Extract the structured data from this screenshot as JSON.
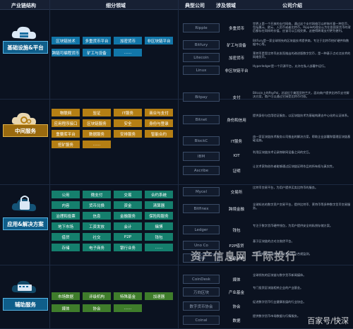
{
  "header": {
    "col_chain": "产业链结构",
    "col_sub": "细分领域",
    "col_company": "典型公司",
    "col_field": "涉及领域",
    "col_intro": "公司介绍"
  },
  "sections": [
    {
      "label": "基础设施&平台",
      "icon": "cloud-server-icon",
      "chips": [
        "区块链技术",
        "多重货币平台",
        "加密货币",
        "非区块链平台",
        "跨链可编程货币",
        "矿工与设备",
        "……"
      ]
    },
    {
      "label": "中间服务",
      "icon": "cloud-gears-icon",
      "chips": [
        "物联网",
        "验证",
        "IT服务",
        "商业与支付",
        "应用程序接口",
        "区块链服务",
        "安全",
        "身份与登录",
        "重要库平台",
        "数据服务",
        "安排服务",
        "智能合约",
        "挖矿服务",
        "……"
      ]
    },
    {
      "label": "应用&解决方案",
      "icon": "padlock-icon",
      "chips": [
        "公用",
        "微支付",
        "交易",
        "合约系统",
        "内容",
        "货币兑换",
        "资金",
        "清算器",
        "治理和投票",
        "信息",
        "金融服务",
        "保险和服务",
        "地下市场",
        "工资发放",
        "会计",
        "赌博",
        "借贷",
        "社交",
        "P2P",
        "钱包",
        "存储",
        "电子商务",
        "银行业务",
        "……"
      ]
    },
    {
      "label": "辅助服务",
      "icon": "keyboard-icon",
      "chips": [
        "市场数据",
        "评级机构",
        "特殊基金",
        "加速器",
        "媒体",
        "协会",
        "……"
      ]
    }
  ],
  "companies": [
    {
      "logo": "Ripple",
      "field": "多重货币",
      "desc": "世界上第一个开放的支付网络，通过这个支付网络可以转账任意一种货币，包括美元、欧元、人民币或者比特币。Ripple的理念认为在各国家货币的背后都存在同样的价值，应该可以互相交换，这使得跨境支付更为便利。"
    },
    {
      "logo": "Bitfury",
      "field": "矿工与设备",
      "desc": "BitFury是一家全球领先的区块链技术提供商，专注于比特币挖矿硬件和数据中心等。"
    },
    {
      "logo": "Litecoin",
      "field": "加密货币",
      "desc": "莱特币是受比特币启发而推出的改进版数字货币，是一种基于点对点技术的网络货币。"
    },
    {
      "logo": "Linux",
      "field": "非区块链平台",
      "desc": "Hyperledger是一个开源平台，允许在私人部署中运行。"
    },
    {
      "logo": "Bitpay",
      "field": "支付",
      "desc": "Bitcoin上的PayPal，总部位于美国亚特兰大，面向商户提供比特币支付解决方案，商户可以通过它接受比特币付款。"
    },
    {
      "logo": "Bitnet",
      "field": "身份和信用",
      "desc": "提供身份与信用验证服务，以区块链技术为基础构建去中心化的认证体系。"
    },
    {
      "logo": "BlockC",
      "field": "IT服务",
      "desc": "由一家区块链技术服务公司推出的解决方案，帮助企业部署和管理区块链基础设施。"
    },
    {
      "logo": "IBM",
      "field": "IOT",
      "desc": "利用区块链技术记录物联网设备之间的交互。"
    },
    {
      "logo": "Ascribe",
      "field": "证明",
      "desc": "让艺术家和创作者能够通过区块链证明作品的所有权与真实性。"
    },
    {
      "logo": "Mycel",
      "field": "交易所",
      "desc": "比特币交易平台，为用户提供买卖比特币的服务。"
    },
    {
      "logo": "Bitfinex",
      "field": "跨境金融",
      "desc": "全球知名的数字资产交易平台，提供比特币、莱特币等多种数字货币交易服务。"
    },
    {
      "logo": "Ledger",
      "field": "钱包",
      "desc": "专注于数字货币硬件钱包，为用户提供安全的私钥存储方案。"
    },
    {
      "logo": "Uno Co",
      "field": "P2P借贷",
      "desc": "基于区块链的点对点借贷平台。"
    },
    {
      "logo": "Ellip",
      "field": "信息分析",
      "desc": "为金融机构提供区块链交易分析与合规监测。"
    },
    {
      "logo": "CoinDesk",
      "field": "媒体",
      "desc": "全球领先的区块链与数字货币新闻媒体。"
    },
    {
      "logo": "万向区块",
      "field": "产业基金",
      "desc": "专门投资区块链相关企业的产业基金。"
    },
    {
      "logo": "数字货币协会",
      "field": "协会",
      "desc": "促进数字货币行业健康发展的行业协会。"
    },
    {
      "logo": "Coinal",
      "field": "数据",
      "desc": "提供数字货币市场数据与行情服务。"
    }
  ],
  "watermark": "资产信息网 千际投行",
  "footer_mark": "百家号/快深",
  "colors": {
    "blue_chip": "#1276a8",
    "gold_chip": "#b57f14",
    "teal_chip": "#157f6d",
    "green_chip": "#3f7d2b"
  }
}
